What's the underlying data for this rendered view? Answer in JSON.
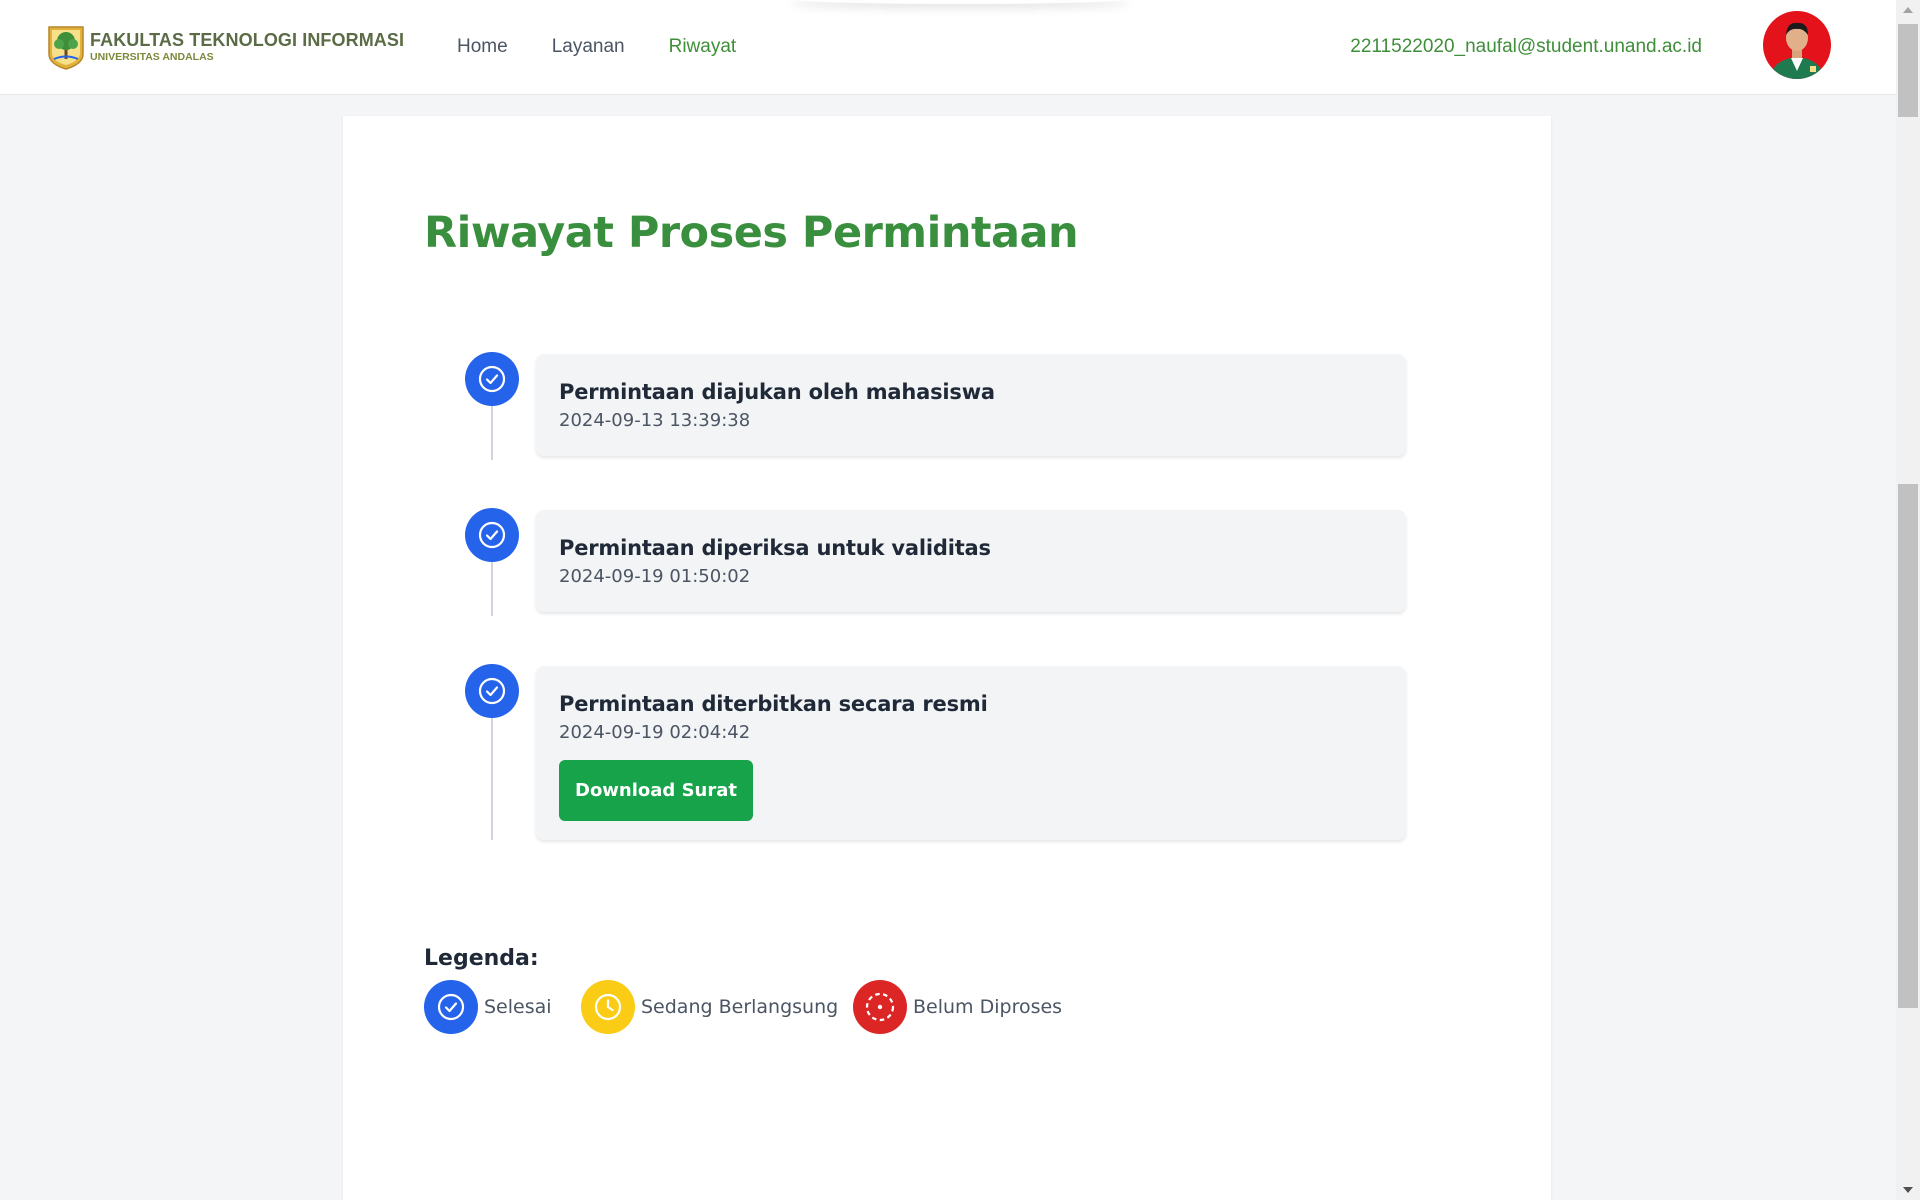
{
  "header": {
    "logo_title": "FAKULTAS TEKNOLOGI INFORMASI",
    "logo_subtitle": "UNIVERSITAS ANDALAS",
    "nav": [
      {
        "label": "Home"
      },
      {
        "label": "Layanan"
      },
      {
        "label": "Riwayat",
        "active": true
      }
    ],
    "user_email": "2211522020_naufal@student.unand.ac.id"
  },
  "page": {
    "title": "Riwayat Proses Permintaan"
  },
  "timeline": [
    {
      "title": "Permintaan diajukan oleh mahasiswa",
      "time": "2024-09-13 13:39:38",
      "status": "Selesai"
    },
    {
      "title": "Permintaan diperiksa untuk validitas",
      "time": "2024-09-19 01:50:02",
      "status": "Selesai"
    },
    {
      "title": "Permintaan diterbitkan secara resmi",
      "time": "2024-09-19 02:04:42",
      "status": "Selesai",
      "action_label": "Download Surat"
    }
  ],
  "legend": {
    "title": "Legenda:",
    "items": [
      {
        "label": "Selesai",
        "color": "#2563eb",
        "icon": "check-circle-icon"
      },
      {
        "label": "Sedang Berlangsung",
        "color": "#facc15",
        "icon": "clock-icon"
      },
      {
        "label": "Belum Diproses",
        "color": "#dc2626",
        "icon": "dashed-circle-icon"
      }
    ]
  },
  "colors": {
    "brand_green": "#3a8f3f",
    "button_green": "#16a34a",
    "done_blue": "#2563eb"
  }
}
